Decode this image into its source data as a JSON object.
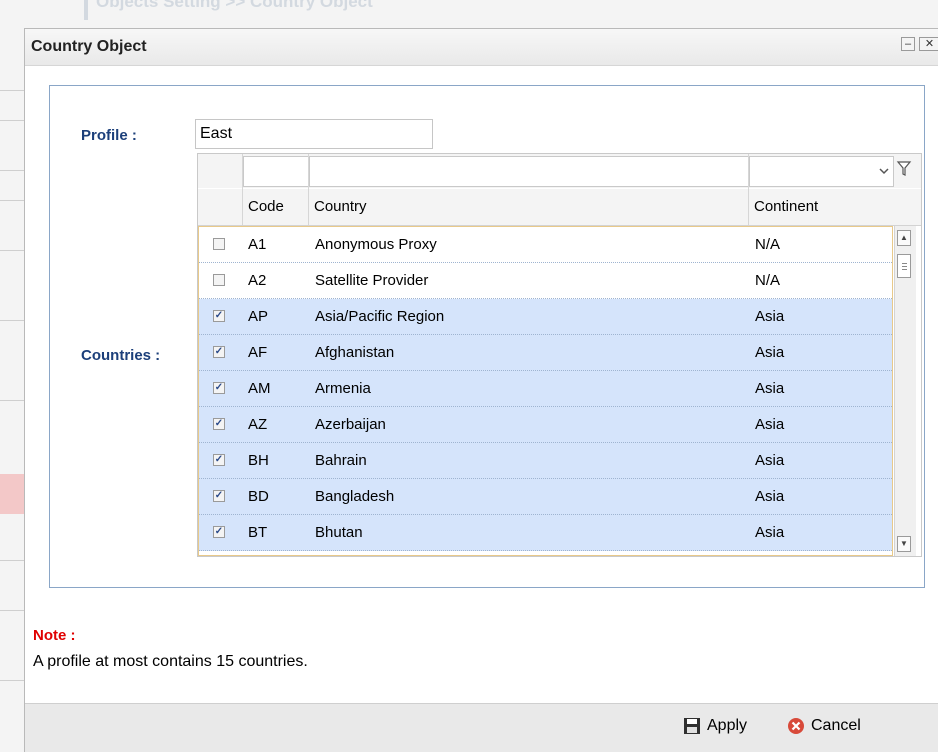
{
  "background": {
    "title": "Objects Setting >> Country Object"
  },
  "dialog": {
    "title": "Country Object",
    "minimize_symbol": "–",
    "close_symbol": "✕"
  },
  "form": {
    "profile_label": "Profile :",
    "profile_value": "East",
    "countries_label": "Countries :"
  },
  "grid": {
    "headers": {
      "code": "Code",
      "country": "Country",
      "continent": "Continent"
    },
    "rows": [
      {
        "checked": false,
        "code": "A1",
        "country": "Anonymous Proxy",
        "continent": "N/A"
      },
      {
        "checked": false,
        "code": "A2",
        "country": "Satellite Provider",
        "continent": "N/A"
      },
      {
        "checked": true,
        "code": "AP",
        "country": "Asia/Pacific Region",
        "continent": "Asia"
      },
      {
        "checked": true,
        "code": "AF",
        "country": "Afghanistan",
        "continent": "Asia"
      },
      {
        "checked": true,
        "code": "AM",
        "country": "Armenia",
        "continent": "Asia"
      },
      {
        "checked": true,
        "code": "AZ",
        "country": "Azerbaijan",
        "continent": "Asia"
      },
      {
        "checked": true,
        "code": "BH",
        "country": "Bahrain",
        "continent": "Asia"
      },
      {
        "checked": true,
        "code": "BD",
        "country": "Bangladesh",
        "continent": "Asia"
      },
      {
        "checked": true,
        "code": "BT",
        "country": "Bhutan",
        "continent": "Asia"
      }
    ]
  },
  "note": {
    "title": "Note :",
    "text": "A profile at most contains 15 countries."
  },
  "footer": {
    "apply_label": "Apply",
    "cancel_label": "Cancel"
  },
  "colors": {
    "selected_row": "#d5e4fb",
    "label_blue": "#1c3f7a",
    "note_red": "#e00000"
  }
}
